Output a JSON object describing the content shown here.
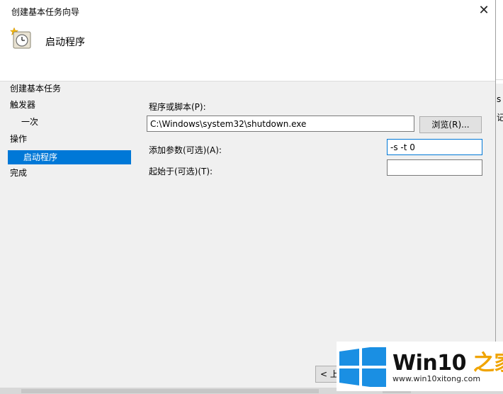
{
  "dialog": {
    "title": "创建基本任务向导",
    "close_glyph": "✕",
    "heading": "启动程序"
  },
  "sidebar": {
    "items": [
      {
        "label": "创建基本任务",
        "level": 1,
        "active": false
      },
      {
        "label": "触发器",
        "level": 1,
        "active": false
      },
      {
        "label": "一次",
        "level": 2,
        "active": false
      },
      {
        "label": "操作",
        "level": 1,
        "active": false
      },
      {
        "label": "启动程序",
        "level": 2,
        "active": true
      },
      {
        "label": "完成",
        "level": 1,
        "active": false
      }
    ]
  },
  "form": {
    "program_label": "程序或脚本(P):",
    "program_value": "C:\\Windows\\system32\\shutdown.exe",
    "browse_label": "浏览(R)...",
    "args_label": "添加参数(可选)(A):",
    "args_value": "-s -t 0",
    "startin_label": "起始于(可选)(T):",
    "startin_value": ""
  },
  "footer": {
    "back_label": "< 上"
  },
  "background_app": {
    "fragment_1": "s",
    "fragment_2": "记"
  },
  "watermark": {
    "brand_main": "Win10 ",
    "brand_accent": "之家",
    "url": "www.win10xitong.com"
  },
  "colors": {
    "accent": "#0078d7",
    "watermark_accent": "#f0a400",
    "logo_blue": "#1a8fe3"
  }
}
